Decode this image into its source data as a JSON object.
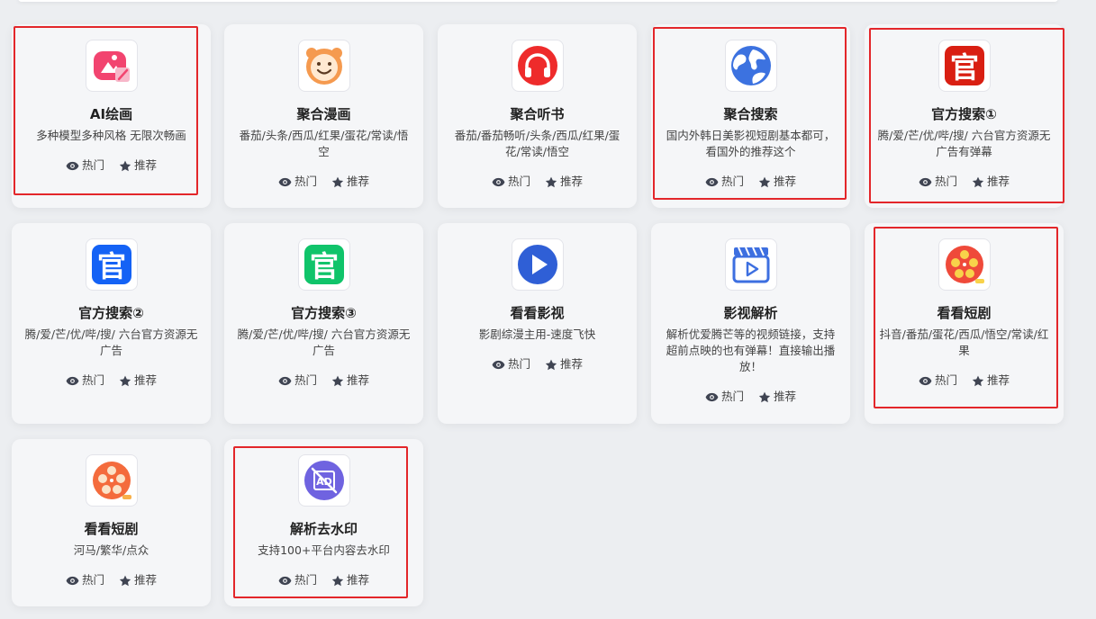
{
  "colors": {
    "page_bg": "#eceef1",
    "card_bg": "#f5f6f8",
    "highlight": "#e3262a"
  },
  "common": {
    "hot_label": "热门",
    "recommend_label": "推荐"
  },
  "cards": [
    {
      "title": "AI绘画",
      "desc": "多种模型多种风格 无限次畅画",
      "icon": "ai-paint-icon",
      "highlighted": true
    },
    {
      "title": "聚合漫画",
      "desc": "番茄/头条/西瓜/红果/蛋花/常读/悟空",
      "icon": "bear-icon",
      "highlighted": false
    },
    {
      "title": "聚合听书",
      "desc": "番茄/番茄畅听/头条/西瓜/红果/蛋花/常读/悟空",
      "icon": "headphones-icon",
      "highlighted": false
    },
    {
      "title": "聚合搜索",
      "desc": "国内外韩日美影视短剧基本都可，看国外的推荐这个",
      "icon": "globe-icon",
      "highlighted": true
    },
    {
      "title": "官方搜索①",
      "desc": "腾/爱/芒/优/哔/搜/ 六台官方资源无广告有弹幕",
      "icon": "official-red-icon",
      "highlighted": true
    },
    {
      "title": "官方搜索②",
      "desc": "腾/爱/芒/优/哔/搜/ 六台官方资源无广告",
      "icon": "official-blue-icon",
      "highlighted": false
    },
    {
      "title": "官方搜索③",
      "desc": "腾/爱/芒/优/哔/搜/ 六台官方资源无广告",
      "icon": "official-green-icon",
      "highlighted": false
    },
    {
      "title": "看看影视",
      "desc": "影剧综漫主用-速度飞快",
      "icon": "play-icon",
      "highlighted": false
    },
    {
      "title": "影视解析",
      "desc": "解析优爱腾芒等的视频链接，支持超前点映的也有弹幕！直接输出播放！",
      "icon": "clapperboard-icon",
      "highlighted": false
    },
    {
      "title": "看看短剧",
      "desc": "抖音/番茄/蛋花/西瓜/悟空/常读/红果",
      "icon": "film-reel-red-icon",
      "highlighted": true
    },
    {
      "title": "看看短剧",
      "desc": "河马/繁华/点众",
      "icon": "film-reel-orange-icon",
      "highlighted": false
    },
    {
      "title": "解析去水印",
      "desc": "支持100+平台内容去水印",
      "icon": "no-watermark-icon",
      "highlighted": true
    }
  ]
}
